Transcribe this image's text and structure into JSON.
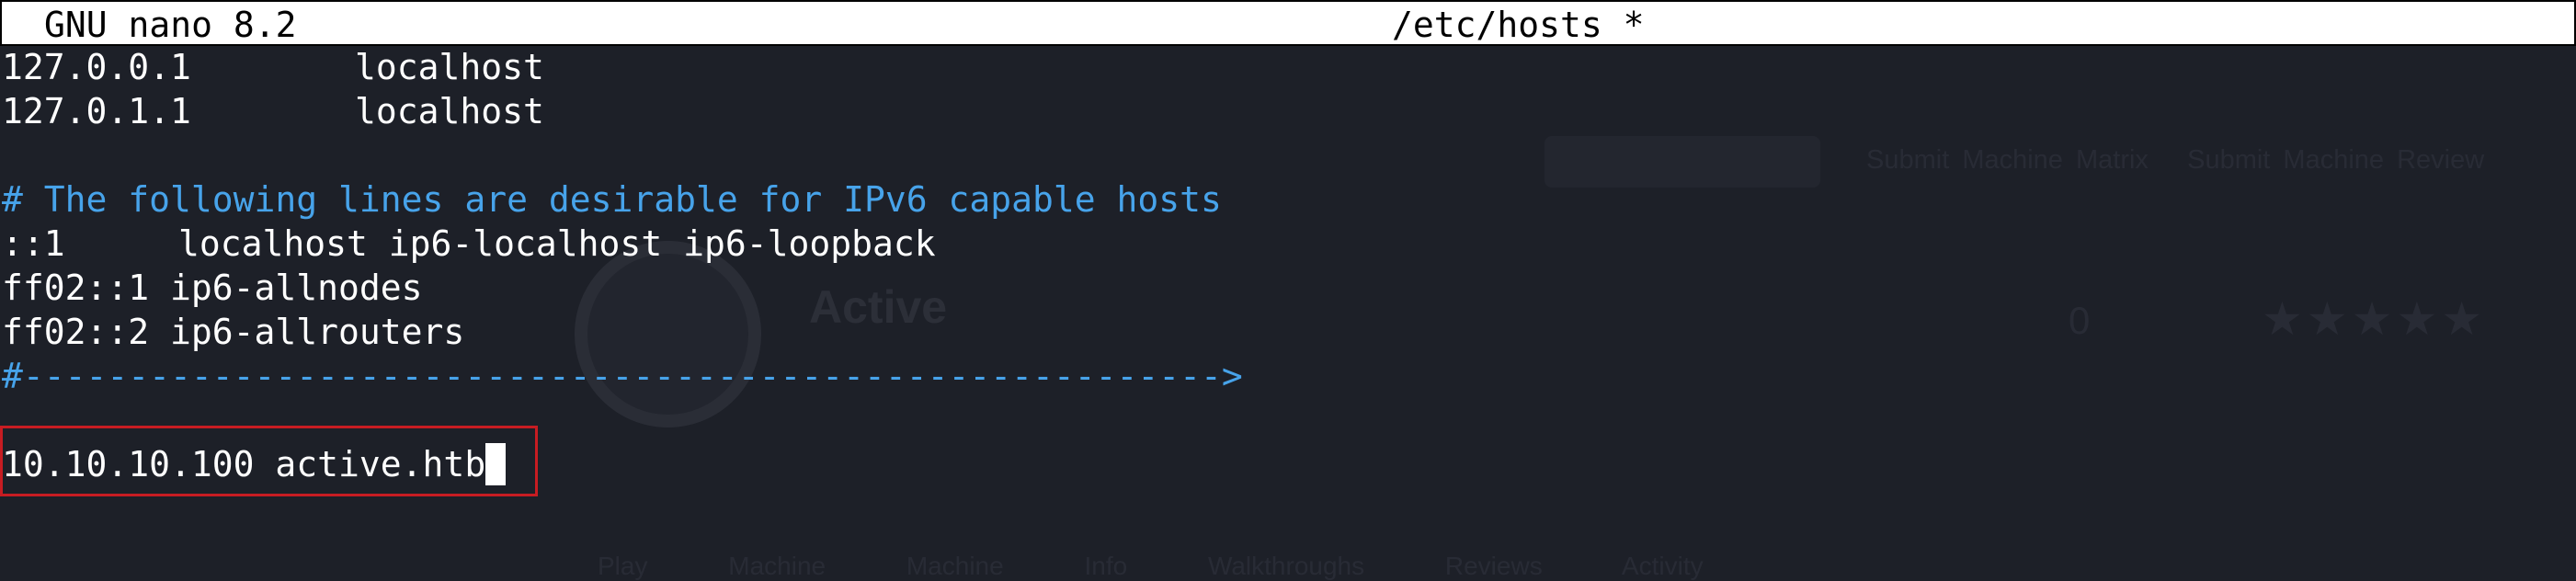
{
  "editor": {
    "app_name": "GNU nano 8.2",
    "file_title": "/etc/hosts *"
  },
  "lines": [
    {
      "address": "127.0.0.1",
      "names": "localhost"
    },
    {
      "address": "127.0.1.1",
      "names": "localhost"
    },
    {
      "comment": "# The following lines are desirable for IPv6 capable hosts"
    },
    {
      "address": "::1",
      "names": "localhost ip6-localhost ip6-loopback"
    },
    {
      "text": "ff02::1 ip6-allnodes"
    },
    {
      "text": "ff02::2 ip6-allrouters"
    },
    {
      "comment": "#--------------------------------------------------------->"
    },
    {
      "text": "10.10.10.100 active.htb"
    }
  ],
  "background_page": {
    "tabs": "Submit Machine Matrix   Submit Machine Review",
    "machine_name": "Active",
    "count": "0",
    "rating": "★★★★★",
    "nav": "Play Machine Machine Info Walkthroughs Reviews Activity"
  },
  "colors": {
    "background": "#1d2028",
    "titlebar": "#ffffff",
    "comment": "#47a3ea",
    "highlight_box": "#c71c22"
  }
}
